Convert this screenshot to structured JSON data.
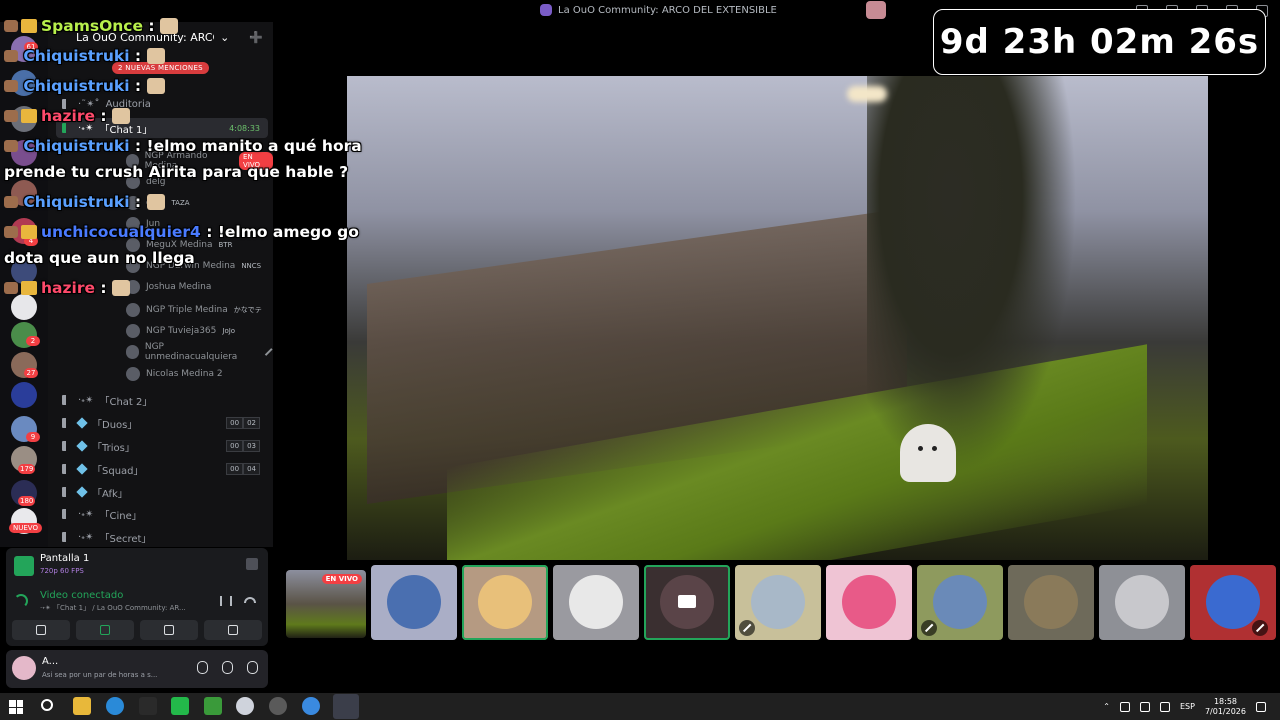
{
  "window": {
    "title": "La OuO Community: ARCO DEL EXTENSIBLE"
  },
  "countdown": "9d 23h 02m 26s",
  "guild": {
    "name": "La OuO Community: ARCO D...",
    "mentions_pill": "2 NUEVAS MENCIONES"
  },
  "rail": {
    "badges": [
      "61",
      "4",
      "2",
      "27",
      "9",
      "179",
      "180"
    ],
    "new_label": "NUEVO"
  },
  "channels": [
    {
      "name": "Auditoria",
      "prefix": "·˜✴˚"
    },
    {
      "name": "「Chat 1」",
      "prefix": "·˖✴",
      "timer": "4:08:33"
    },
    {
      "name": "「Chat 2」",
      "prefix": "·˖✴"
    },
    {
      "name": "「Duos」",
      "prefix": "·˖✴",
      "count_a": "00",
      "count_b": "02"
    },
    {
      "name": "「Trios」",
      "prefix": "·˖✴",
      "count_a": "00",
      "count_b": "03"
    },
    {
      "name": "「Squad」",
      "prefix": "·˖✴",
      "count_a": "00",
      "count_b": "04"
    },
    {
      "name": "「Afk」",
      "prefix": "·˖✴"
    },
    {
      "name": "「Cine」",
      "prefix": "·˖✴"
    },
    {
      "name": "「Secret」",
      "prefix": "·˖✴"
    }
  ],
  "members": [
    {
      "name": "NGP Armando Medina",
      "tag": "",
      "live": "EN VIVO"
    },
    {
      "name": "delg",
      "tag": ""
    },
    {
      "name": "dina",
      "tag": "TAZA"
    },
    {
      "name": "Jun",
      "tag": ""
    },
    {
      "name": "MeguX Medina",
      "tag": "BTR"
    },
    {
      "name": "NGP Darwin Medina",
      "tag": "NNCS"
    },
    {
      "name": "Joshua Medina",
      "tag": ""
    },
    {
      "name": "NGP Triple Medina",
      "tag": "かなでテ"
    },
    {
      "name": "NGP Tuvieja365",
      "tag": "JoJo"
    },
    {
      "name": "NGP unmedinacualquiera",
      "tag": ""
    },
    {
      "name": "Nicolas Medina 2",
      "tag": ""
    }
  ],
  "chat": [
    {
      "user": "SpamsOnce",
      "text": " : "
    },
    {
      "user": "Chiquistruki",
      "text": " : "
    },
    {
      "user": "Chiquistruki",
      "text": " : "
    },
    {
      "user": "hazire",
      "text": " : "
    },
    {
      "user": "Chiquistruki",
      "text": " : !elmo manito a qué hora"
    },
    {
      "user": "",
      "text": "prende tu crush Airita para que hable ?"
    },
    {
      "user": "Chiquistruki",
      "text": " : "
    },
    {
      "user": "unchicocualquier4",
      "text": " : !elmo amego go"
    },
    {
      "user": "",
      "text": "dota que aun no llega"
    },
    {
      "user": "hazire",
      "text": " : "
    }
  ],
  "screen_share": {
    "title": "Pantalla 1",
    "quality": "720p 60 FPS"
  },
  "voice": {
    "status": "Video conectado",
    "location": "·˖✴ 「Chat 1」 / La OuO Community: AR..."
  },
  "user": {
    "name": "A...",
    "status": "Asi sea por un par de horas a s..."
  },
  "stream_strip": {
    "live_label": "EN VIVO"
  },
  "tray": {
    "language": "ESP",
    "time": "18:58",
    "date": "7/01/2026"
  },
  "colors": {
    "accent_green": "#23a55a",
    "live_red": "#f23f43",
    "sidebar_bg": "#121214"
  }
}
